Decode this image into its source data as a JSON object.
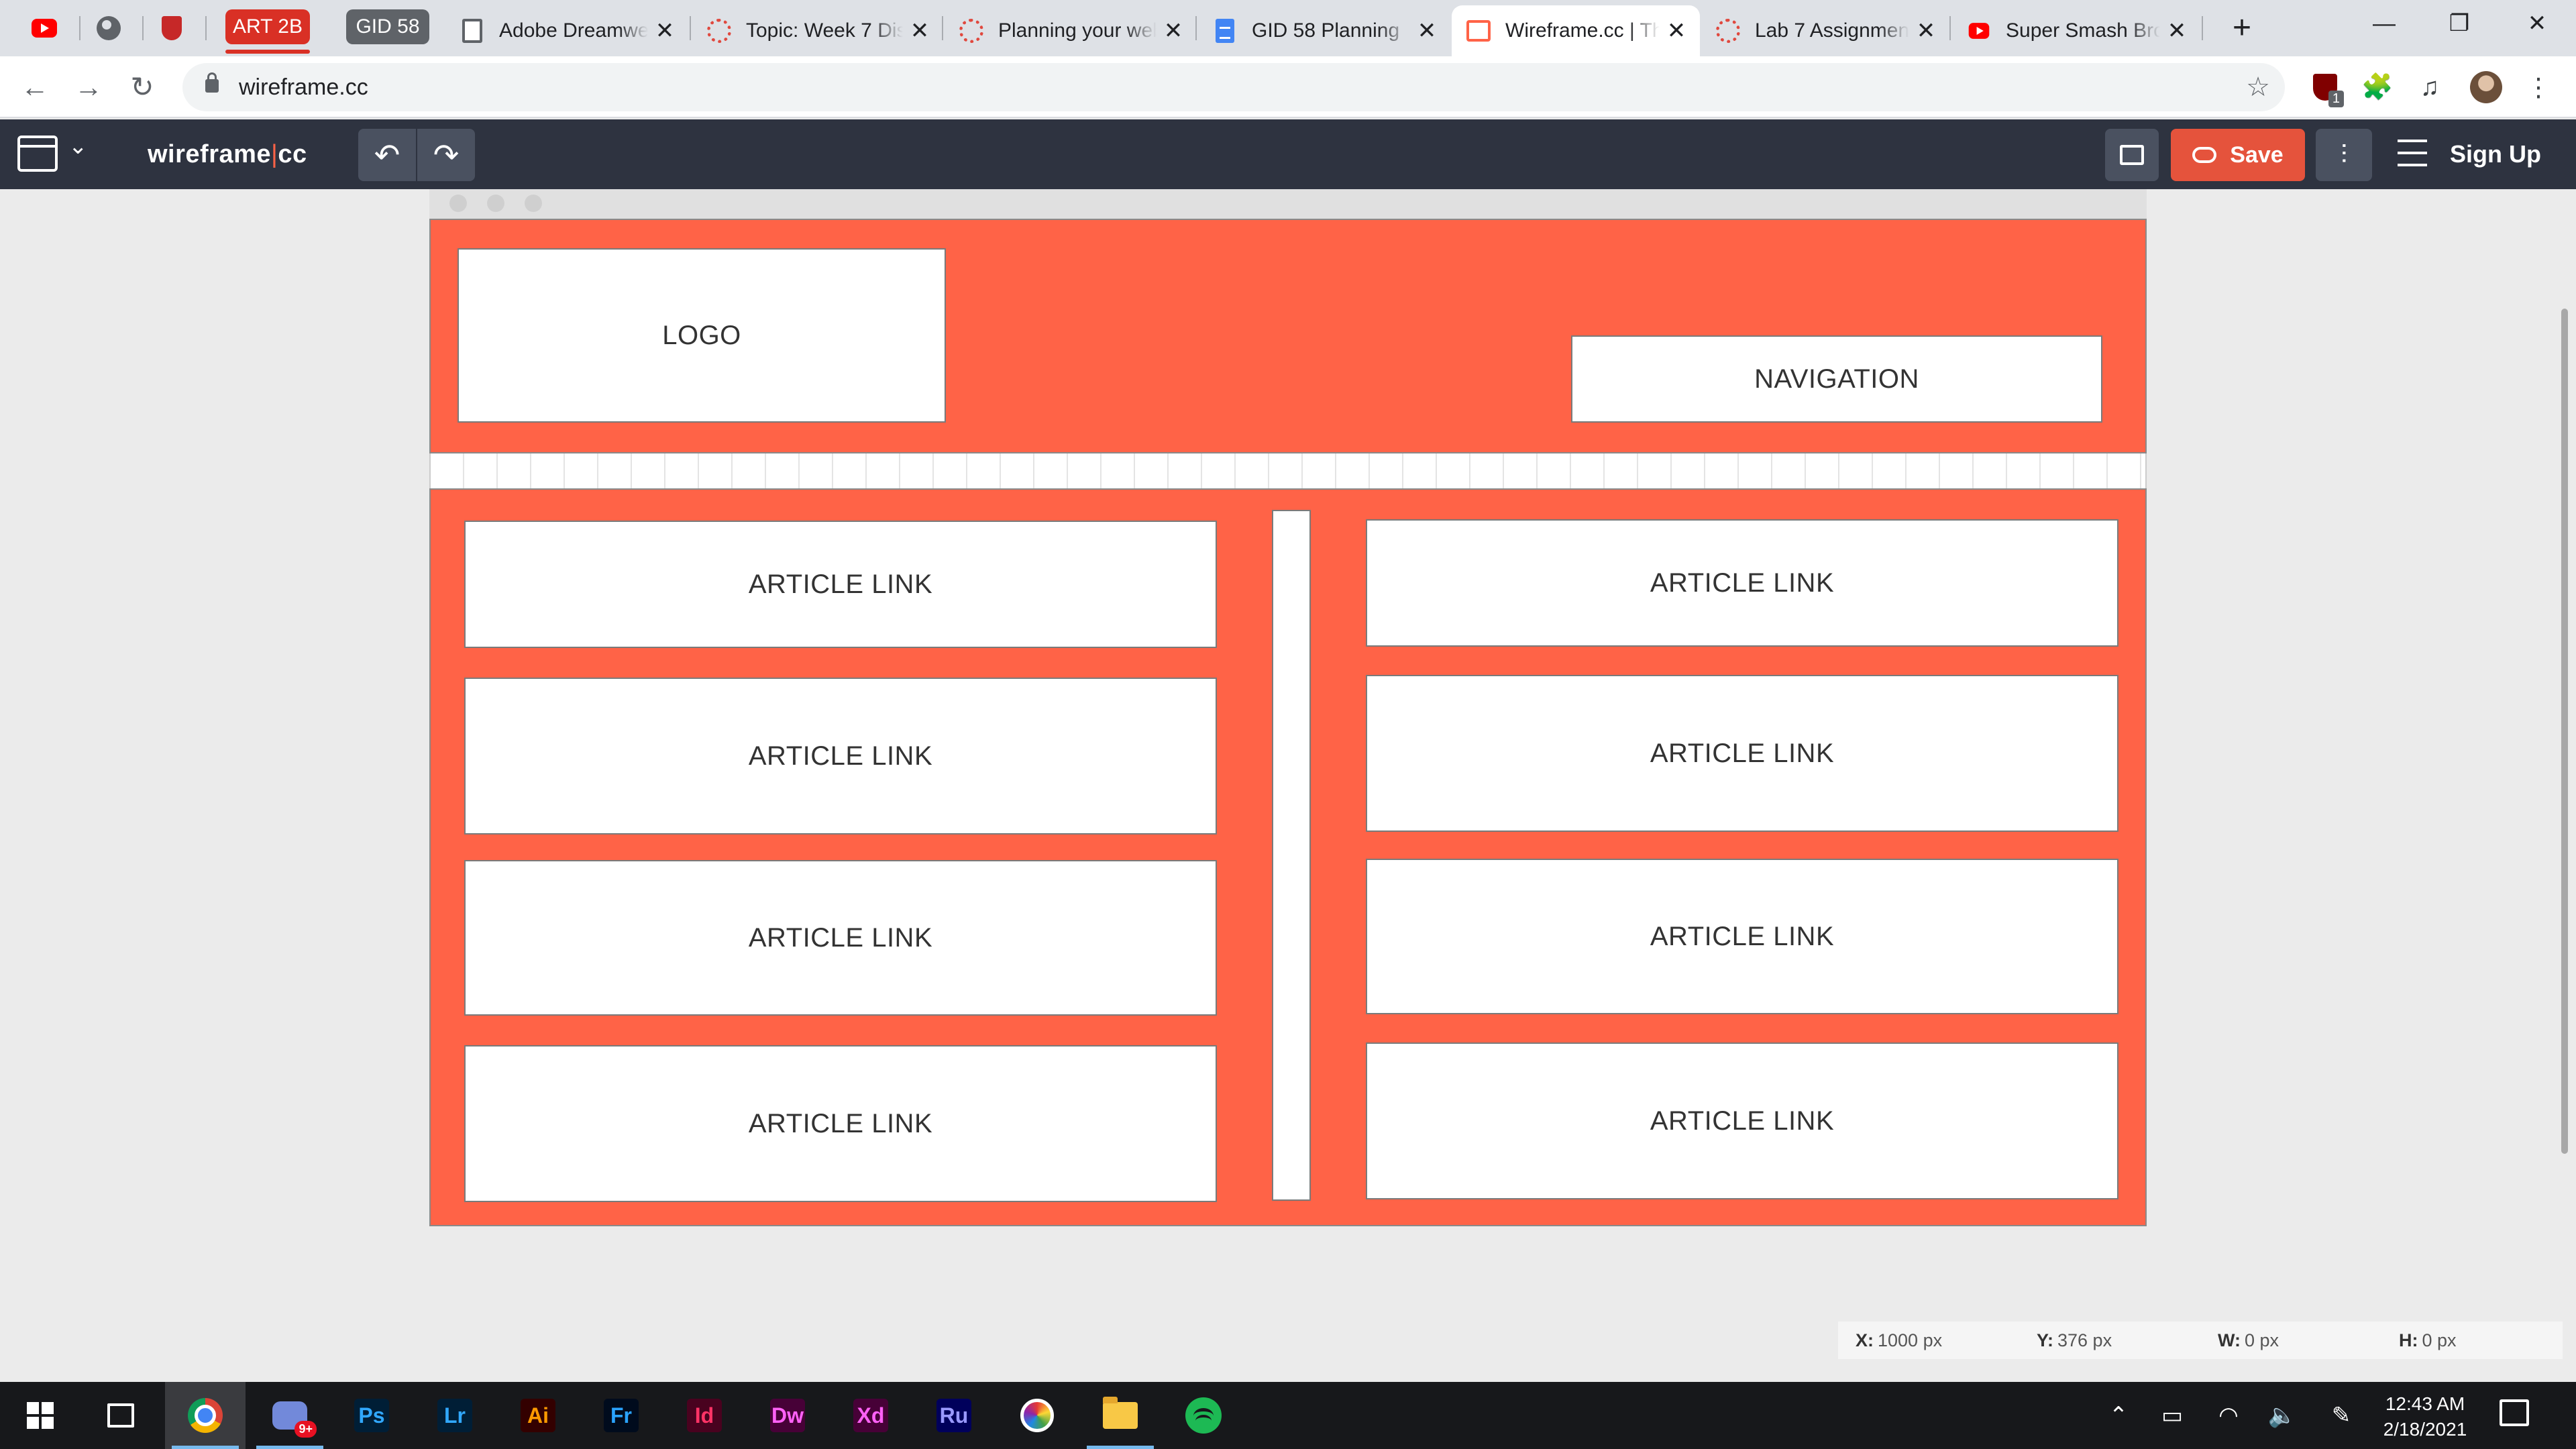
{
  "browser": {
    "tab_groups": [
      {
        "label": "ART 2B",
        "color": "#d93025"
      },
      {
        "label": "GID 58",
        "color": "#5f6368"
      }
    ],
    "tabs": [
      {
        "title": "Adobe Dreamweaver",
        "icon": "doc-icon"
      },
      {
        "title": "Topic: Week 7 Discussion",
        "icon": "canvas-icon"
      },
      {
        "title": "Planning your website",
        "icon": "canvas-icon"
      },
      {
        "title": "GID 58 Planning",
        "icon": "google-docs-icon"
      },
      {
        "title": "Wireframe.cc | The",
        "icon": "wireframe-icon",
        "active": true
      },
      {
        "title": "Lab 7 Assignment",
        "icon": "canvas-icon"
      },
      {
        "title": "Super Smash Bros",
        "icon": "youtube-icon"
      }
    ],
    "url": "wireframe.cc",
    "extension_badge": "1"
  },
  "app": {
    "brand_left": "wireframe",
    "brand_sep": "|",
    "brand_right": "cc",
    "save_label": "Save",
    "signup_label": "Sign Up",
    "accent": "#ff6347"
  },
  "wireframe": {
    "logo_label": "LOGO",
    "navigation_label": "NAVIGATION",
    "article_label": "ARTICLE LINK"
  },
  "readout": {
    "x_label": "X:",
    "x_value": "1000 px",
    "y_label": "Y:",
    "y_value": "376 px",
    "w_label": "W:",
    "w_value": "0 px",
    "h_label": "H:",
    "h_value": "0 px"
  },
  "taskbar": {
    "discord_badge": "9+",
    "apps": [
      "Ps",
      "Lr",
      "Ai",
      "Fr",
      "Id",
      "Dw",
      "Xd",
      "Ru"
    ],
    "time": "12:43 AM",
    "date": "2/18/2021"
  }
}
